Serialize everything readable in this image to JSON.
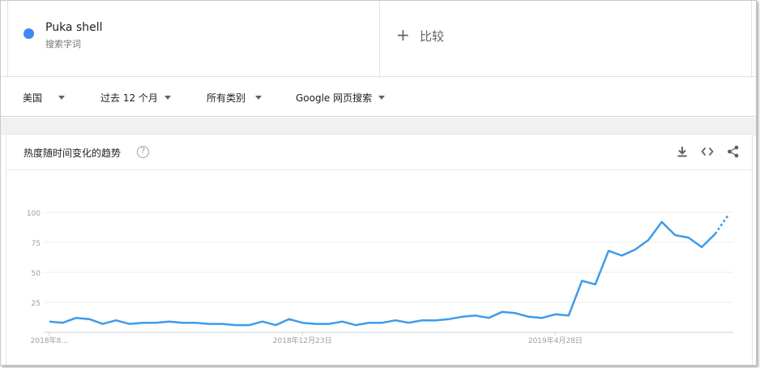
{
  "search_term": {
    "name": "Puka shell",
    "type_label": "搜索字词",
    "color": "#4285f4"
  },
  "compare": {
    "plus": "+",
    "label": "比较"
  },
  "filters": {
    "region": "美国",
    "time_range": "过去 12 个月",
    "category": "所有类别",
    "search_type": "Google 网页搜索"
  },
  "card": {
    "title": "热度随时间变化的趋势",
    "help_glyph": "?",
    "icons": [
      "download-icon",
      "embed-code-icon",
      "share-icon"
    ]
  },
  "chart_data": {
    "type": "line",
    "title": "热度随时间变化的趋势",
    "ylim": [
      0,
      100
    ],
    "y_ticks": [
      25,
      50,
      75,
      100
    ],
    "x_tick_labels": [
      "2018年8…",
      "2018年12月23日",
      "2019年4月28日"
    ],
    "grid": true,
    "series": [
      {
        "color": "#4285f4",
        "values": [
          9,
          8,
          12,
          11,
          7,
          10,
          7,
          8,
          8,
          9,
          8,
          8,
          7,
          7,
          6,
          6,
          9,
          6,
          11,
          8,
          7,
          7,
          9,
          6,
          8,
          8,
          10,
          8,
          10,
          10,
          11,
          13,
          14,
          12,
          17,
          16,
          13,
          12,
          15,
          14,
          43,
          40,
          68,
          64,
          69,
          77,
          92,
          81,
          79,
          71,
          82
        ],
        "partial_tail": [
          82,
          98
        ]
      }
    ]
  }
}
